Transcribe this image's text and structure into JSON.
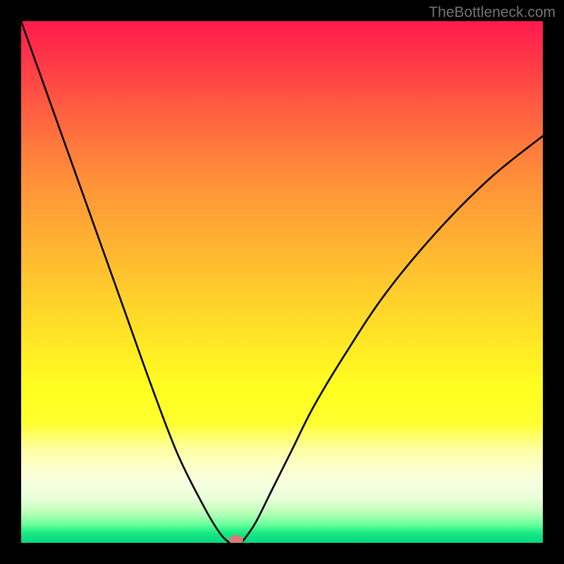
{
  "watermark": "TheBottleneck.com",
  "chart_data": {
    "type": "line",
    "title": "",
    "xlabel": "",
    "ylabel": "",
    "xlim": [
      0,
      100
    ],
    "ylim": [
      0,
      100
    ],
    "grid": false,
    "background": "gradient-red-yellow-green",
    "series": [
      {
        "name": "bottleneck-curve",
        "x": [
          0,
          5,
          10,
          15,
          20,
          25,
          30,
          35,
          38,
          40,
          41,
          42,
          43,
          45,
          48,
          52,
          56,
          62,
          70,
          80,
          90,
          100
        ],
        "y": [
          100,
          86,
          72,
          58,
          44,
          30,
          17,
          7,
          2,
          0,
          0,
          0,
          1,
          4,
          10,
          18,
          26,
          36,
          48,
          60,
          70,
          78
        ]
      }
    ],
    "marker": {
      "x": 41.2,
      "y": 0.5,
      "color": "#d97a78"
    },
    "gradient_stops": [
      {
        "pos": 0,
        "color": "#ff1a4d"
      },
      {
        "pos": 50,
        "color": "#ffd020"
      },
      {
        "pos": 75,
        "color": "#ffff30"
      },
      {
        "pos": 100,
        "color": "#0ad880"
      }
    ]
  }
}
